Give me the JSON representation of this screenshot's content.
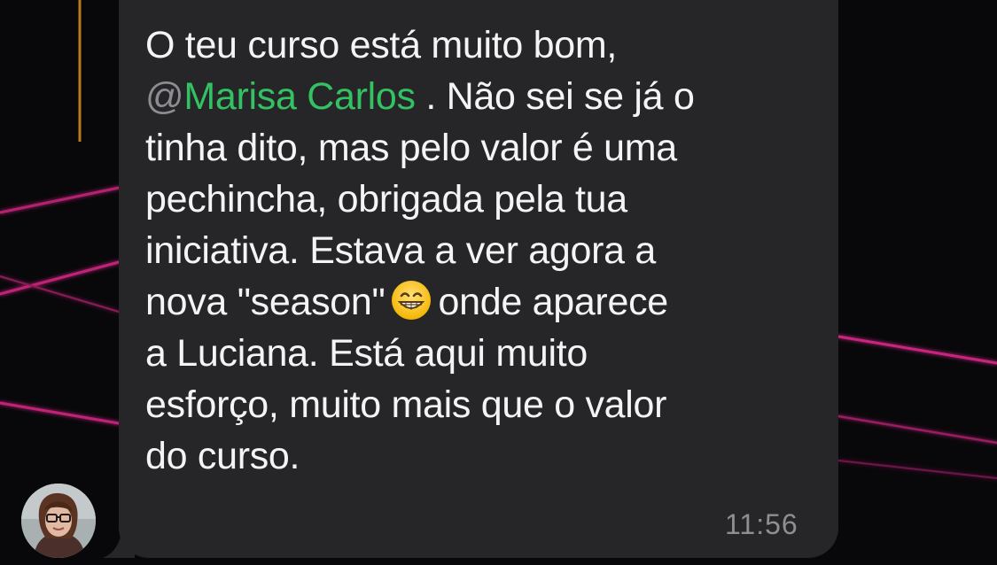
{
  "message": {
    "lines": {
      "l1": "O teu curso está muito bom,",
      "l2_at": "@",
      "l2_mention": "Marisa Carlos",
      "l2_rest": " . Não sei se já o",
      "l3": "tinha dito, mas pelo valor é uma",
      "l4": "pechincha, obrigada pela tua",
      "l5": "iniciativa. Estava a ver agora a",
      "l6_pre": "nova \"season\"",
      "l6_post": "onde aparece",
      "l7": "a Luciana. Está aqui muito",
      "l8": "esforço, muito mais que o valor",
      "l9": "do curso."
    },
    "emoji": "grinning-face-with-smiling-eyes",
    "time": "11:56"
  },
  "colors": {
    "bubble": "#262628",
    "text": "#f4f4f6",
    "mention": "#33c163",
    "timestamp": "#8e8e93",
    "neon": "#c0207a"
  }
}
